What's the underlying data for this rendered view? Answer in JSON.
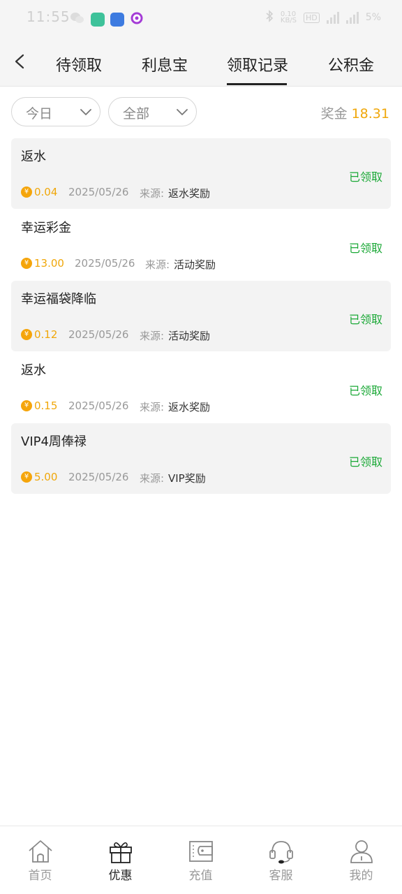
{
  "status_bar": {
    "time": "11:55",
    "speed": "0.10",
    "speed_unit": "KB/S",
    "battery": "5%",
    "volte": "HD"
  },
  "header": {
    "tabs": [
      {
        "label": "待领取"
      },
      {
        "label": "利息宝"
      },
      {
        "label": "领取记录"
      },
      {
        "label": "公积金"
      }
    ],
    "active_tab": "领取记录"
  },
  "filters": {
    "date_filter": "今日",
    "type_filter": "全部"
  },
  "bonus": {
    "label": "奖金",
    "value": "18.31"
  },
  "records": [
    {
      "title": "返水",
      "status": "已领取",
      "amount": "0.04",
      "date": "2025/05/26",
      "source_label": "来源:",
      "source": "返水奖励"
    },
    {
      "title": "幸运彩金",
      "status": "已领取",
      "amount": "13.00",
      "date": "2025/05/26",
      "source_label": "来源:",
      "source": "活动奖励"
    },
    {
      "title": "幸运福袋降临",
      "status": "已领取",
      "amount": "0.12",
      "date": "2025/05/26",
      "source_label": "来源:",
      "source": "活动奖励"
    },
    {
      "title": "返水",
      "status": "已领取",
      "amount": "0.15",
      "date": "2025/05/26",
      "source_label": "来源:",
      "source": "返水奖励"
    },
    {
      "title": "VIP4周俸禄",
      "status": "已领取",
      "amount": "5.00",
      "date": "2025/05/26",
      "source_label": "来源:",
      "source": "VIP奖励"
    }
  ],
  "currency_symbol": "¥",
  "bottom_nav": [
    {
      "label": "首页",
      "icon": "home-icon"
    },
    {
      "label": "优惠",
      "icon": "gift-icon"
    },
    {
      "label": "充值",
      "icon": "wallet-icon"
    },
    {
      "label": "客服",
      "icon": "headset-icon"
    },
    {
      "label": "我的",
      "icon": "user-icon"
    }
  ],
  "active_nav": "优惠",
  "colors": {
    "accent_gold": "#f0a70a",
    "status_green": "#1aa836",
    "text_dark": "#222222",
    "text_muted": "#999999"
  }
}
